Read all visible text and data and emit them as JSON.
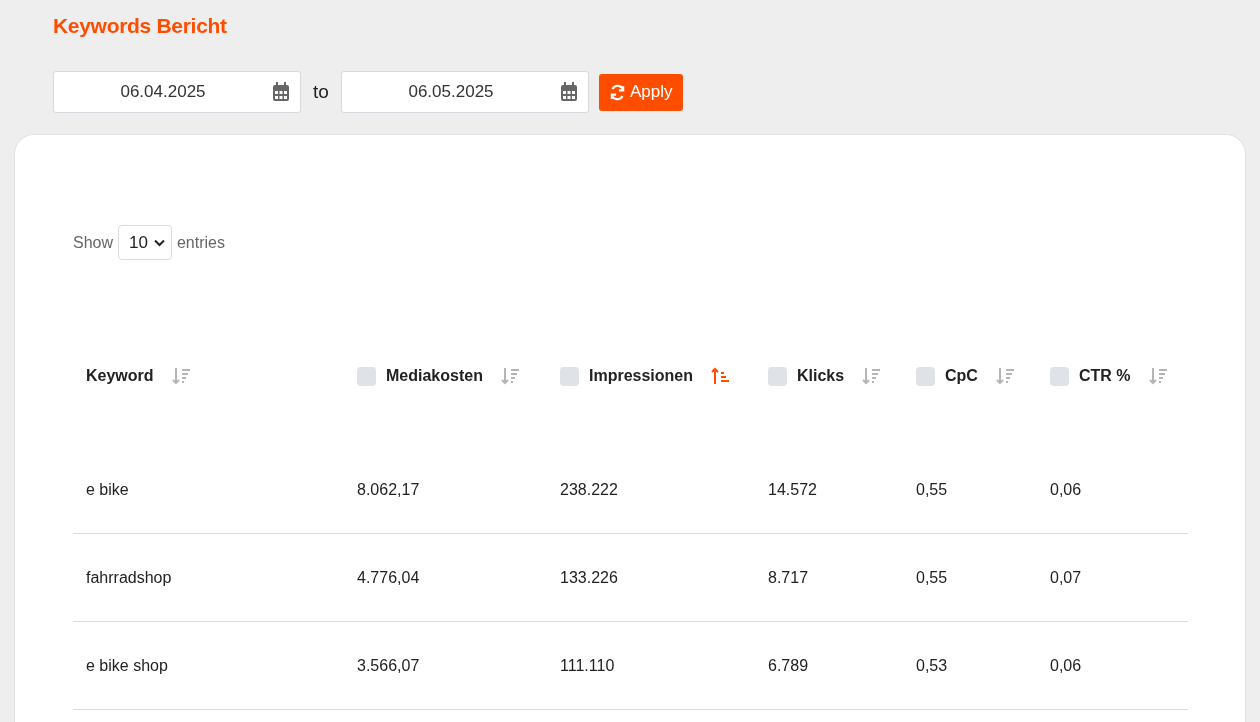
{
  "title": "Keywords Bericht",
  "date_range": {
    "from": "06.04.2025",
    "separator": "to",
    "to": "06.05.2025",
    "apply": "Apply"
  },
  "length_menu": {
    "before": "Show",
    "value": "10",
    "after": "entries"
  },
  "table": {
    "columns": [
      {
        "label": "Keyword",
        "kind": "plain",
        "sorted": false
      },
      {
        "label": "Mediakosten",
        "kind": "checkbox",
        "checked": false,
        "sorted": false
      },
      {
        "label": "Impressionen",
        "kind": "checkbox",
        "checked": false,
        "sorted": true
      },
      {
        "label": "Klicks",
        "kind": "checkbox",
        "checked": false,
        "sorted": false
      },
      {
        "label": "CpC",
        "kind": "checkbox",
        "checked": false,
        "sorted": false
      },
      {
        "label": "CTR %",
        "kind": "checkbox",
        "checked": false,
        "sorted": false
      }
    ],
    "rows": [
      [
        "e bike",
        "8.062,17",
        "238.222",
        "14.572",
        "0,55",
        "0,06"
      ],
      [
        "fahrradshop",
        "4.776,04",
        "133.226",
        "8.717",
        "0,55",
        "0,07"
      ],
      [
        "e bike shop",
        "3.566,07",
        "111.110",
        "6.789",
        "0,53",
        "0,06"
      ]
    ]
  }
}
